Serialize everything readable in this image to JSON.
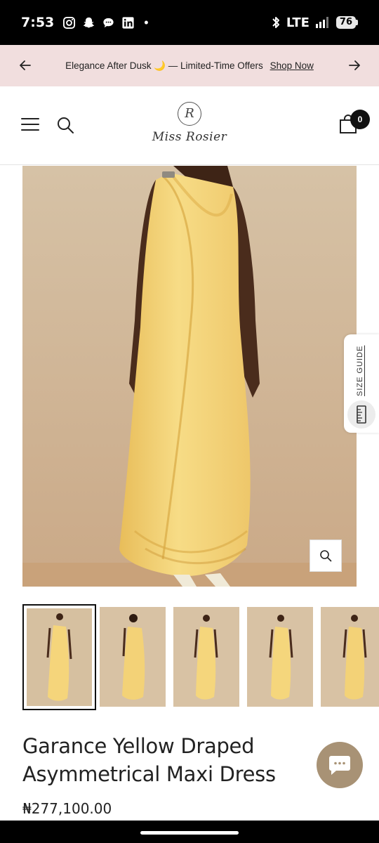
{
  "status_bar": {
    "time": "7:53",
    "network": "LTE",
    "battery": "76",
    "dot": "•"
  },
  "announcement": {
    "text": "Elegance After Dusk 🌙 — Limited-Time Offers",
    "link": "Shop Now"
  },
  "header": {
    "logo_emblem": "R",
    "logo_text": "Miss Rosier",
    "cart_count": "0"
  },
  "gallery": {
    "size_guide_label": "SIZE GUIDE",
    "thumbnail_count": 5,
    "active_index": 0
  },
  "product": {
    "title": "Garance Yellow Draped Asymmetrical Maxi Dress",
    "price": "₦277,100.00"
  },
  "colors": {
    "announcement_bg": "#f1dede",
    "dress_yellow": "#f3d277",
    "backdrop": "#d8c2a4",
    "chat_button": "#a89275"
  }
}
